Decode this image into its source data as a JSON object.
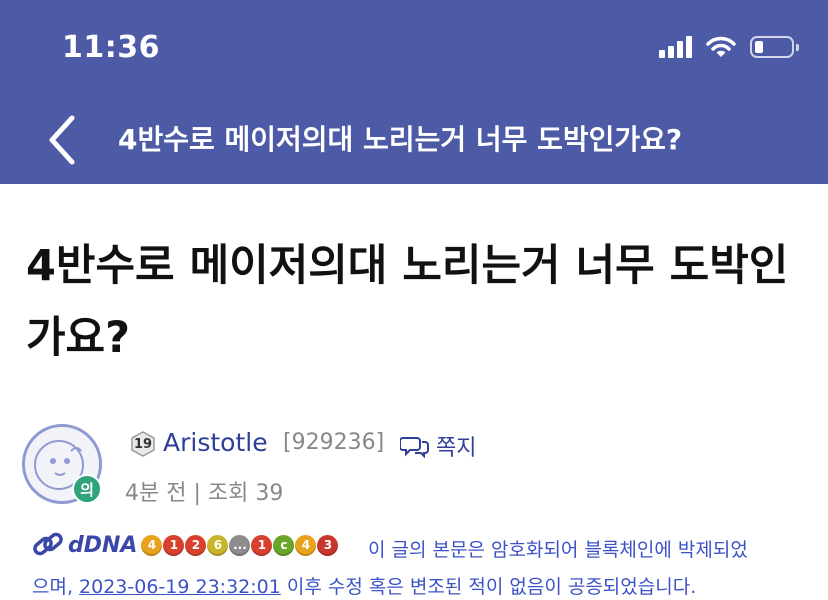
{
  "status_bar": {
    "time": "11:36"
  },
  "header": {
    "title": "4반수로 메이저의대 노리는거 너무 도박인가요?"
  },
  "post": {
    "title": "4반수로 메이저의대 노리는거 너무 도박인가요?",
    "author": {
      "level": "19",
      "avatar_badge": "의",
      "name": "Aristotle",
      "id": "[929236]",
      "message_label": "쪽지"
    },
    "meta": "4분 전 | 조회 39"
  },
  "dna": {
    "label": "dDNA",
    "badges": [
      {
        "text": "4",
        "color": "#e8a21c"
      },
      {
        "text": "1",
        "color": "#d9412f"
      },
      {
        "text": "2",
        "color": "#d9412f"
      },
      {
        "text": "6",
        "color": "#c9b52a"
      },
      {
        "text": "...",
        "color": "#8c8c8c"
      },
      {
        "text": "1",
        "color": "#d9412f"
      },
      {
        "text": "c",
        "color": "#6aa62a"
      },
      {
        "text": "4",
        "color": "#e8a21c"
      },
      {
        "text": "3",
        "color": "#c8372d"
      }
    ],
    "notice_part1": "이 글의 본문은 암호화되어 블록체인에 박제되었",
    "notice_part2": "으며,",
    "timestamp": "2023-06-19 23:32:01",
    "notice_part3": "이후 수정 혹은 변조된 적이 없음이 공증되었습니다."
  },
  "colors": {
    "header_bg": "#4d5aa5",
    "link": "#3c52c7",
    "author": "#2d3f98",
    "meta": "#888888"
  }
}
